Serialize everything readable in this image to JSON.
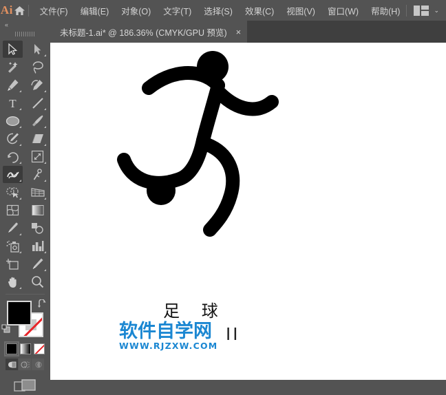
{
  "app": {
    "logo_text": "Ai",
    "home_icon": "home-icon",
    "workspace_icon": "workspace-layout-icon",
    "workspace_chevron": "⌄"
  },
  "menubar": {
    "items": [
      {
        "label": "文件(F)",
        "name": "menu-file"
      },
      {
        "label": "编辑(E)",
        "name": "menu-edit"
      },
      {
        "label": "对象(O)",
        "name": "menu-object"
      },
      {
        "label": "文字(T)",
        "name": "menu-type"
      },
      {
        "label": "选择(S)",
        "name": "menu-select"
      },
      {
        "label": "效果(C)",
        "name": "menu-effect"
      },
      {
        "label": "视图(V)",
        "name": "menu-view"
      },
      {
        "label": "窗口(W)",
        "name": "menu-window"
      },
      {
        "label": "帮助(H)",
        "name": "menu-help"
      }
    ]
  },
  "tabbar": {
    "tab_label": "未标题-1.ai* @ 186.36% (CMYK/GPU 预览)",
    "close_glyph": "×"
  },
  "toolbar": {
    "collapse_glyph": "«",
    "tools": [
      {
        "name": "selection-tool",
        "selected": true,
        "corner": false
      },
      {
        "name": "direct-selection-tool",
        "selected": false,
        "corner": true
      },
      {
        "name": "magic-wand-tool",
        "selected": false,
        "corner": false
      },
      {
        "name": "lasso-tool",
        "selected": false,
        "corner": false
      },
      {
        "name": "pen-tool",
        "selected": false,
        "corner": true
      },
      {
        "name": "curvature-tool",
        "selected": false,
        "corner": true
      },
      {
        "name": "type-tool",
        "selected": false,
        "corner": true
      },
      {
        "name": "line-segment-tool",
        "selected": false,
        "corner": true
      },
      {
        "name": "ellipse-tool",
        "selected": false,
        "corner": true
      },
      {
        "name": "paintbrush-tool",
        "selected": false,
        "corner": true
      },
      {
        "name": "shaper-tool",
        "selected": false,
        "corner": true
      },
      {
        "name": "eraser-tool",
        "selected": false,
        "corner": true
      },
      {
        "name": "rotate-tool",
        "selected": false,
        "corner": true
      },
      {
        "name": "scale-tool",
        "selected": false,
        "corner": true
      },
      {
        "name": "puppet-warp-tool",
        "selected": true,
        "corner": true
      },
      {
        "name": "free-transform-tool",
        "selected": false,
        "corner": true
      },
      {
        "name": "shape-builder-tool",
        "selected": false,
        "corner": true
      },
      {
        "name": "perspective-grid-tool",
        "selected": false,
        "corner": true
      },
      {
        "name": "mesh-tool",
        "selected": false,
        "corner": false
      },
      {
        "name": "gradient-tool",
        "selected": false,
        "corner": false
      },
      {
        "name": "eyedropper-tool",
        "selected": false,
        "corner": true
      },
      {
        "name": "blend-tool",
        "selected": false,
        "corner": false
      },
      {
        "name": "symbol-sprayer-tool",
        "selected": false,
        "corner": true
      },
      {
        "name": "column-graph-tool",
        "selected": false,
        "corner": true
      },
      {
        "name": "artboard-tool",
        "selected": false,
        "corner": false
      },
      {
        "name": "slice-tool",
        "selected": false,
        "corner": true
      },
      {
        "name": "hand-tool",
        "selected": false,
        "corner": true
      },
      {
        "name": "zoom-tool",
        "selected": false,
        "corner": false
      }
    ],
    "color": {
      "fill_color": "#000000",
      "stroke_color": "none",
      "swap_icon": "swap-fill-stroke-icon",
      "default_icon": "default-fill-stroke-icon",
      "swatches": [
        {
          "name": "color-swatch",
          "kind": "color",
          "active": true
        },
        {
          "name": "gradient-swatch",
          "kind": "gradient",
          "active": false
        },
        {
          "name": "none-swatch",
          "kind": "none",
          "active": false
        }
      ],
      "draw_modes": [
        {
          "name": "draw-normal-mode",
          "active": true
        },
        {
          "name": "draw-behind-mode",
          "active": false
        },
        {
          "name": "draw-inside-mode",
          "active": false
        }
      ],
      "screen_mode": "change-screen-mode-icon"
    }
  },
  "canvas": {
    "artwork_name": "soccer-player-pictogram",
    "artwork_label": "足  球",
    "artwork_mark": "II",
    "watermark": {
      "main": "软件自学网",
      "sub": "WWW.RJZXW.COM",
      "color": "#1b87d2"
    }
  },
  "colors": {
    "chrome": "#535353",
    "tabstrip": "#3f3f3f",
    "accent_orange": "#e39160",
    "canvas_bg": "#ffffff",
    "artwork_black": "#000000"
  }
}
